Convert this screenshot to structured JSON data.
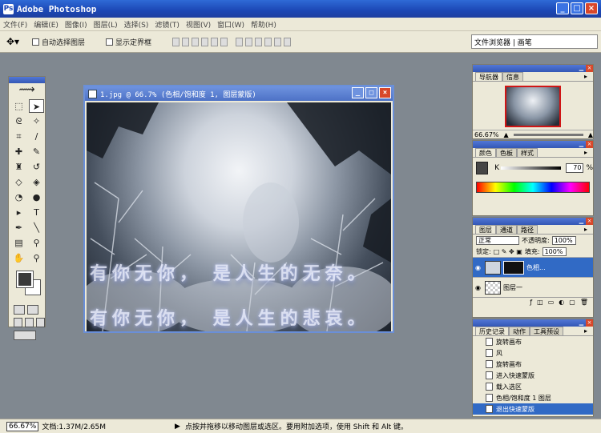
{
  "app": {
    "title": "Adobe Photoshop"
  },
  "window_buttons": {
    "minimize": "_",
    "maximize": "□",
    "close": "×"
  },
  "menu": [
    "文件(F)",
    "编辑(E)",
    "图像(I)",
    "图层(L)",
    "选择(S)",
    "滤镜(T)",
    "视图(V)",
    "窗口(W)",
    "帮助(H)"
  ],
  "options": {
    "auto_select_label": "自动选择图层",
    "show_bounds_label": "显示定界框",
    "palette_well": "文件浏览器 | 画笔"
  },
  "document": {
    "title": "1.jpg @ 66.7% (色相/饱和度 1, 图层蒙版)",
    "overlay_line1": "有你无你， 是人生的无奈。",
    "overlay_line2": "有你无你， 是人生的悲哀。"
  },
  "navigator": {
    "tabs": [
      "导航器",
      "信息"
    ],
    "zoom": "66.67%"
  },
  "color_palette": {
    "tabs": [
      "颜色",
      "色板",
      "样式"
    ],
    "channel": "K",
    "value": "70",
    "unit": "%"
  },
  "layers": {
    "tabs": [
      "图层",
      "通道",
      "路径"
    ],
    "blend_mode": "正常",
    "opacity_label": "不透明度:",
    "opacity": "100%",
    "lock_label": "锁定:",
    "fill_label": "填充:",
    "fill": "100%",
    "items": [
      {
        "name": "色相...",
        "active": true
      },
      {
        "name": "图层一",
        "active": false
      }
    ]
  },
  "history": {
    "tabs": [
      "历史记录",
      "动作",
      "工具预设"
    ],
    "items": [
      "旋转画布",
      "风",
      "旋转画布",
      "进入快速蒙版",
      "载入选区",
      "色相/饱和度 1 图层",
      "退出快速蒙版"
    ],
    "active_index": 6
  },
  "status": {
    "zoom": "66.67%",
    "doc_size": "文档:1.37M/2.65M",
    "hint": "点按并拖移以移动图层或选区。要用附加选项，使用 Shift 和 Alt 键。"
  },
  "colors": {
    "title_bar": "#1c47b5",
    "selection": "#316ac5",
    "nav_frame": "#d01515",
    "foreground": "#464646"
  }
}
